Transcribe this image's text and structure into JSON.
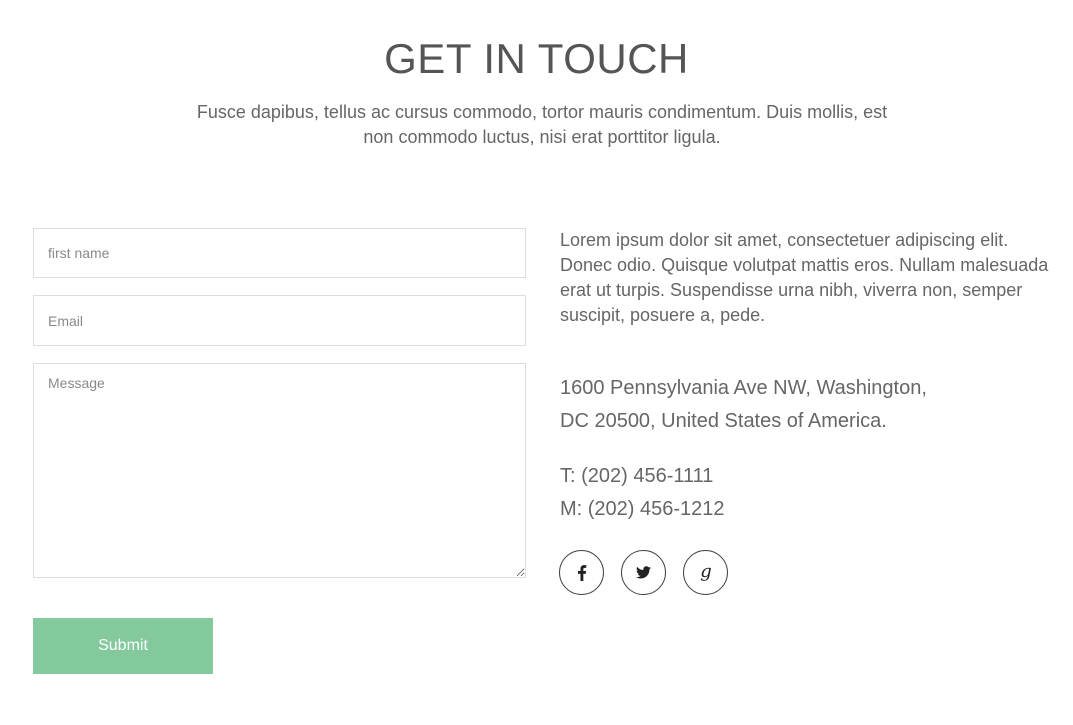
{
  "header": {
    "title": "GET IN TOUCH",
    "subtitle": "Fusce dapibus, tellus ac cursus commodo, tortor mauris condimentum. Duis mollis, est non commodo luctus, nisi erat porttitor ligula."
  },
  "form": {
    "first_name": {
      "placeholder": "first name",
      "value": ""
    },
    "email": {
      "placeholder": "Email",
      "value": ""
    },
    "message": {
      "placeholder": "Message",
      "value": ""
    },
    "submit_label": "Submit",
    "submit_color": "#83c99b"
  },
  "contact": {
    "intro": "Lorem ipsum dolor sit amet, consectetuer adipiscing elit. Donec odio. Quisque volutpat mattis eros. Nullam malesuada erat ut turpis. Suspendisse urna nibh, viverra non, semper suscipit, posuere a, pede.",
    "address_line1": "1600 Pennsylvania Ave NW, Washington,",
    "address_line2": "DC 20500, United States of America.",
    "telephone": "T: (202) 456-1111",
    "mobile": "M: (202) 456-1212"
  },
  "social": [
    {
      "network": "facebook",
      "icon": "facebook-icon"
    },
    {
      "network": "twitter",
      "icon": "twitter-icon"
    },
    {
      "network": "google-plus",
      "icon": "google-plus-icon"
    }
  ]
}
